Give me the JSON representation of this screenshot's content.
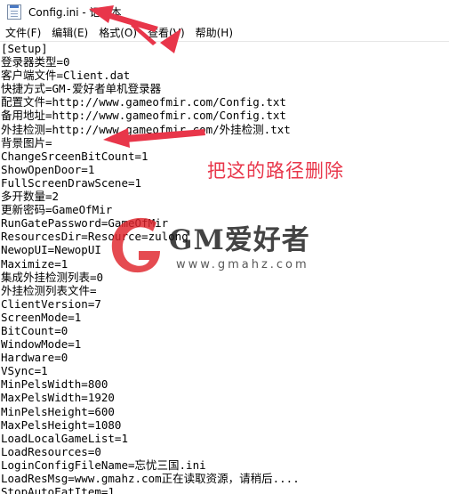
{
  "window": {
    "title": "Config.ini - 记事本"
  },
  "menubar": [
    {
      "label": "文件(F)"
    },
    {
      "label": "编辑(E)"
    },
    {
      "label": "格式(O)"
    },
    {
      "label": "查看(V)"
    },
    {
      "label": "帮助(H)"
    }
  ],
  "editor": {
    "lines": [
      "[Setup]",
      "登录器类型=0",
      "客户端文件=Client.dat",
      "快捷方式=GM-爱好者单机登录器",
      "配置文件=http://www.gameofmir.com/Config.txt",
      "备用地址=http://www.gameofmir.com/Config.txt",
      "外挂检测=http://www.gameofmir.com/外挂检测.txt",
      "背景图片=",
      "ChangeSrceenBitCount=1",
      "ShowOpenDoor=1",
      "FullScreenDrawScene=1",
      "多开数量=2",
      "更新密码=GameOfMir",
      "RunGatePassword=GameOfMir",
      "ResourcesDir=Resource=zulong",
      "NewopUI=NewopUI",
      "Maximize=1",
      "集成外挂检测列表=0",
      "外挂检测列表文件=",
      "ClientVersion=7",
      "ScreenMode=1",
      "BitCount=0",
      "WindowMode=1",
      "Hardware=0",
      "VSync=1",
      "MinPelsWidth=800",
      "MaxPelsWidth=1920",
      "MinPelsHeight=600",
      "MaxPelsHeight=1080",
      "LoadLocalGameList=1",
      "LoadResources=0",
      "LoginConfigFileName=忘忧三国.ini",
      "LoadResMsg=www.gmahz.com正在读取资源，请稍后....",
      "StopAutoEatItem=1"
    ]
  },
  "annotation": {
    "text": "把这的路径删除",
    "color": "#e8364a"
  },
  "watermark": {
    "title": "GM爱好者",
    "url": "www.gmahz.com",
    "accent": "#e0242b"
  }
}
